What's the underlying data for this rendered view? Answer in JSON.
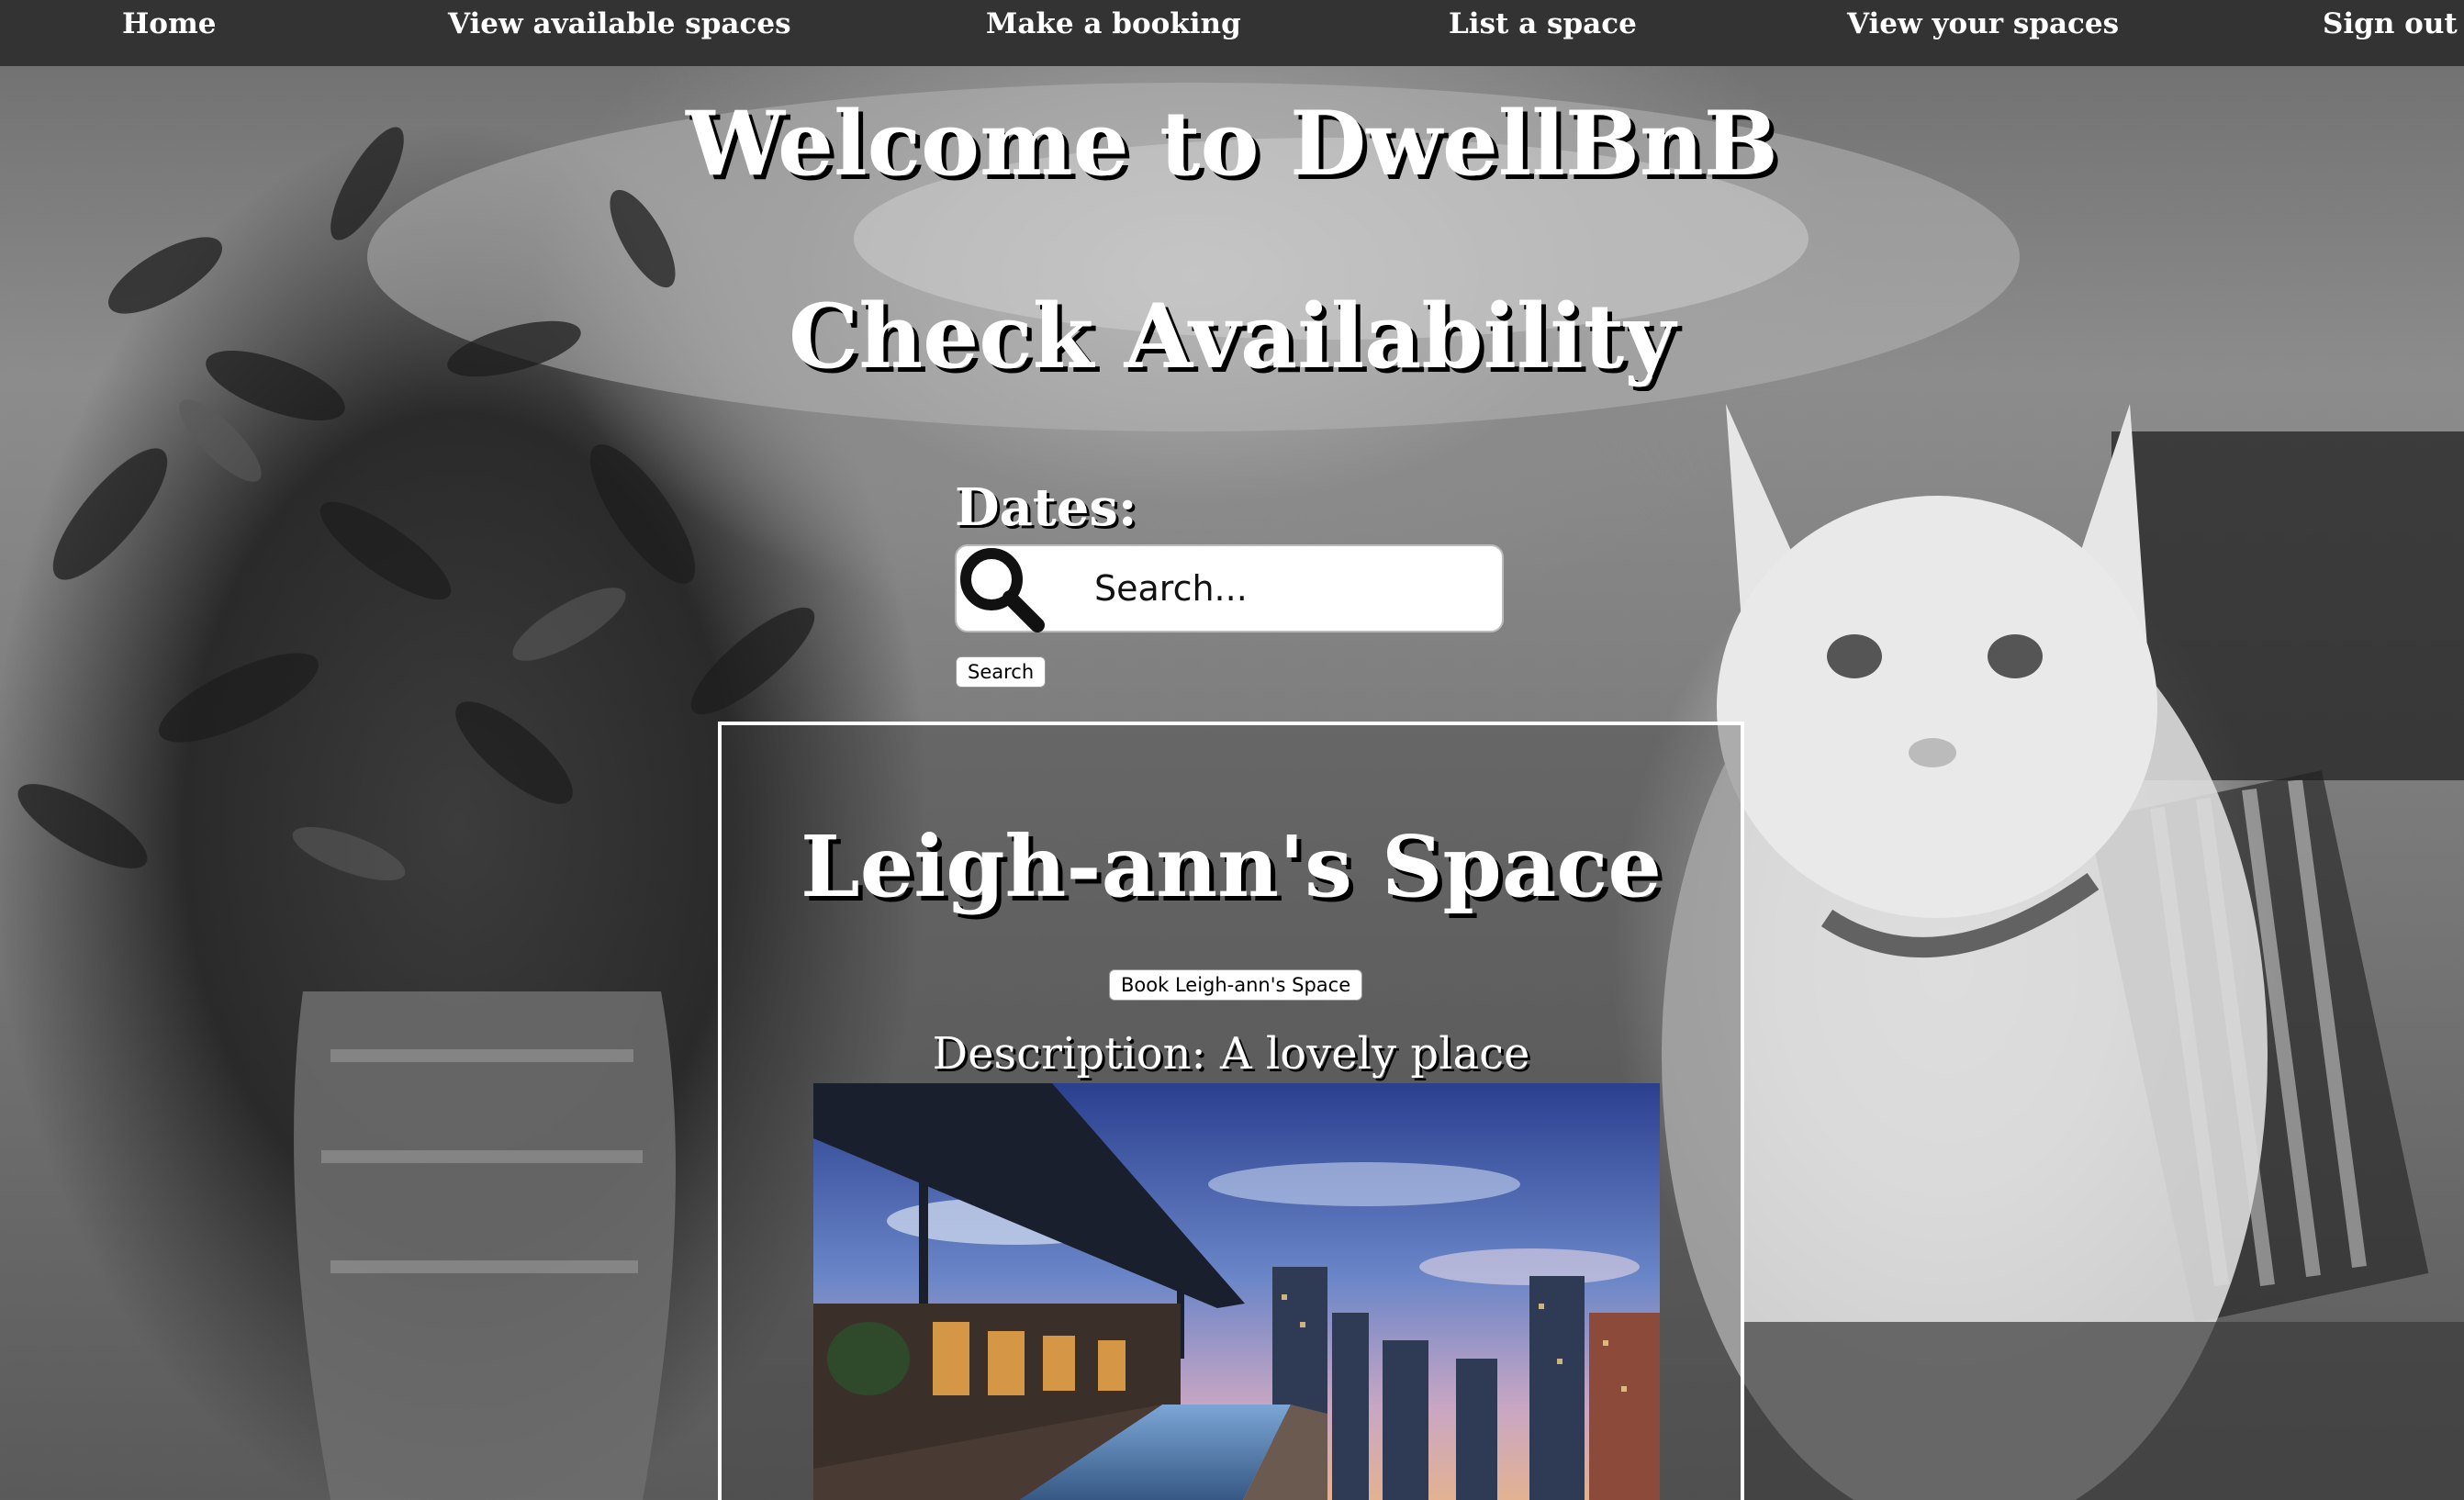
{
  "nav": {
    "home": "Home",
    "view_spaces": "View available spaces",
    "make_booking": "Make a booking",
    "list_space": "List a space",
    "your_spaces": "View your spaces",
    "sign_out": "Sign out"
  },
  "header": {
    "title": "Welcome to DwellBnB"
  },
  "availability": {
    "title": "Check Availability",
    "dates_label": "Dates:",
    "search_placeholder": "Search...",
    "search_button": "Search"
  },
  "space": {
    "title": "Leigh-ann's Space",
    "book_button": "Book Leigh-ann's Space",
    "description": "Description: A lovely place"
  },
  "colors": {
    "navbar": "#333333",
    "text": "#ffffff",
    "shadow": "#000000"
  }
}
